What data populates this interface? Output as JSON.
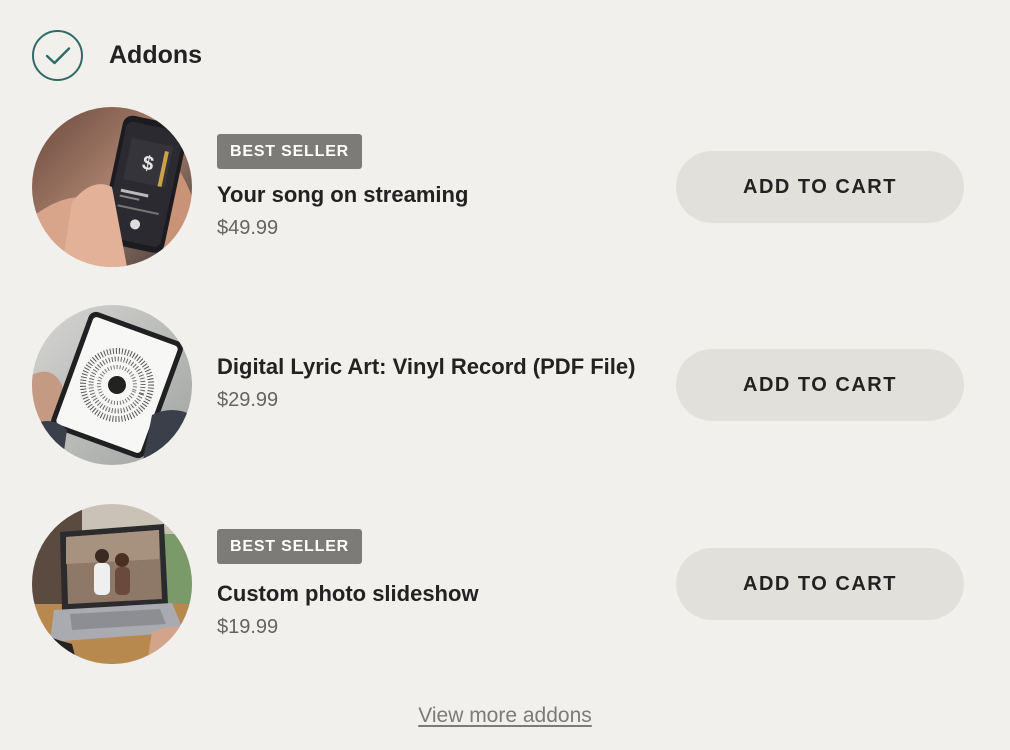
{
  "header": {
    "title": "Addons",
    "check_icon": "check-icon",
    "accent_color": "#2f6b66"
  },
  "addons": [
    {
      "badge": "BEST SELLER",
      "name": "Your song on streaming",
      "price": "$49.99",
      "button_label": "ADD TO CART",
      "image": "phone-streaming-image"
    },
    {
      "badge": "",
      "name": "Digital Lyric Art: Vinyl Record (PDF File)",
      "price": "$29.99",
      "button_label": "ADD TO CART",
      "image": "tablet-vinyl-art-image"
    },
    {
      "badge": "BEST SELLER",
      "name": "Custom photo slideshow",
      "price": "$19.99",
      "button_label": "ADD TO CART",
      "image": "laptop-slideshow-image"
    }
  ],
  "footer": {
    "view_more_label": "View more addons"
  },
  "colors": {
    "background": "#f2f0ec",
    "badge": "#7d7b77",
    "button": "#e2e0db"
  }
}
